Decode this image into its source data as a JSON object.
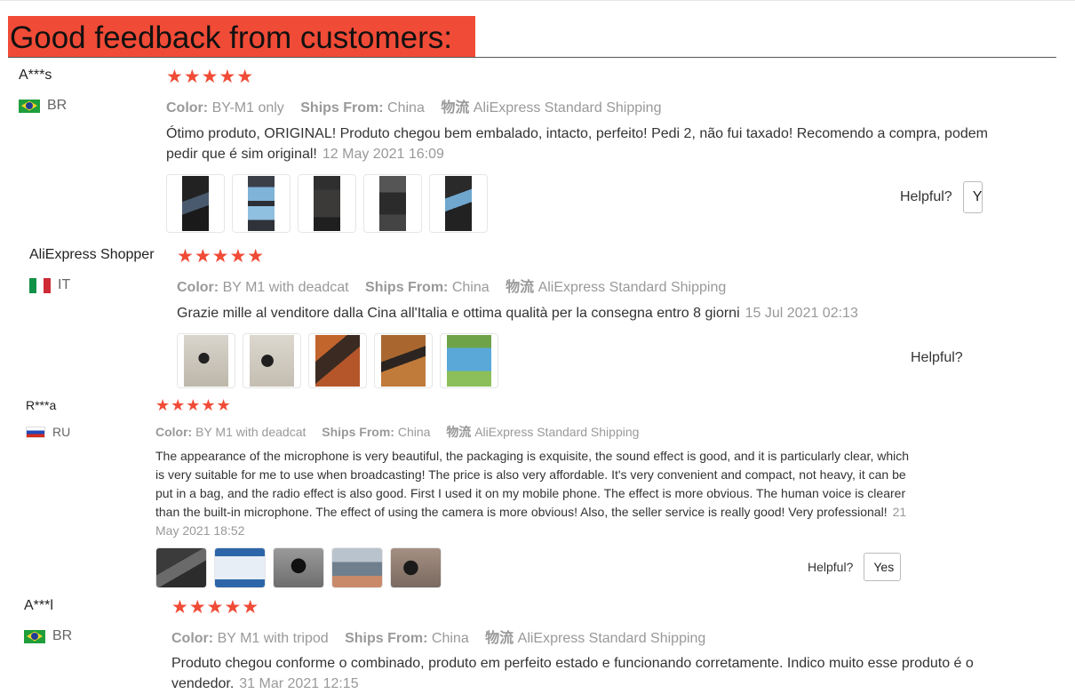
{
  "banner": {
    "title": "Good feedback from customers:"
  },
  "labels": {
    "color": "Color:",
    "ships_from": "Ships From:",
    "shipping_method": "物流",
    "helpful": "Helpful?"
  },
  "reviews": [
    {
      "user": "A***s",
      "country": "BR",
      "stars": "★★★★★",
      "rating": 5,
      "color": "BY-M1 only",
      "ships_from": "China",
      "shipping": "AliExpress Standard Shipping",
      "text": "Ótimo produto, ORIGINAL! Produto chegou bem embalado, intacto, perfeito! Pedi 2, não fui taxado! Recomendo a compra, podem pedir que é sim original!",
      "date": "12 May 2021 16:09",
      "yes_label": "Y"
    },
    {
      "user": "AliExpress Shopper",
      "country": "IT",
      "stars": "★★★★★",
      "rating": 5,
      "color": "BY M1 with deadcat",
      "ships_from": "China",
      "shipping": "AliExpress Standard Shipping",
      "text": "Grazie mille al venditore dalla Cina all'Italia e ottima qualità per la consegna entro 8 giorni",
      "date": "15 Jul 2021 02:13"
    },
    {
      "user": "R***a",
      "country": "RU",
      "stars": "★★★★★",
      "rating": 5,
      "color": "BY M1 with deadcat",
      "ships_from": "China",
      "shipping": "AliExpress Standard Shipping",
      "text": "The appearance of the microphone is very beautiful, the packaging is exquisite, the sound effect is good, and it is particularly clear, which is very suitable for me to use when broadcasting! The price is also very affordable. It's very convenient and compact, not heavy, it can be put in a bag, and the radio effect is also good. First I used it on my mobile phone. The effect is more obvious. The human voice is clearer than the built-in microphone. The effect of using the camera is more obvious! Also, the seller service is really good! Very professional!",
      "date": "21 May 2021 18:52",
      "yes_label": "Yes"
    },
    {
      "user": "A***l",
      "country": "BR",
      "stars": "★★★★★",
      "rating": 5,
      "color": "BY M1 with tripod",
      "ships_from": "China",
      "shipping": "AliExpress Standard Shipping",
      "text": "Produto chegou conforme o combinado, produto em perfeito estado e funcionando corretamente. Indico muito esse produto é o vendedor.",
      "date": "31 Mar 2021 12:15"
    }
  ]
}
